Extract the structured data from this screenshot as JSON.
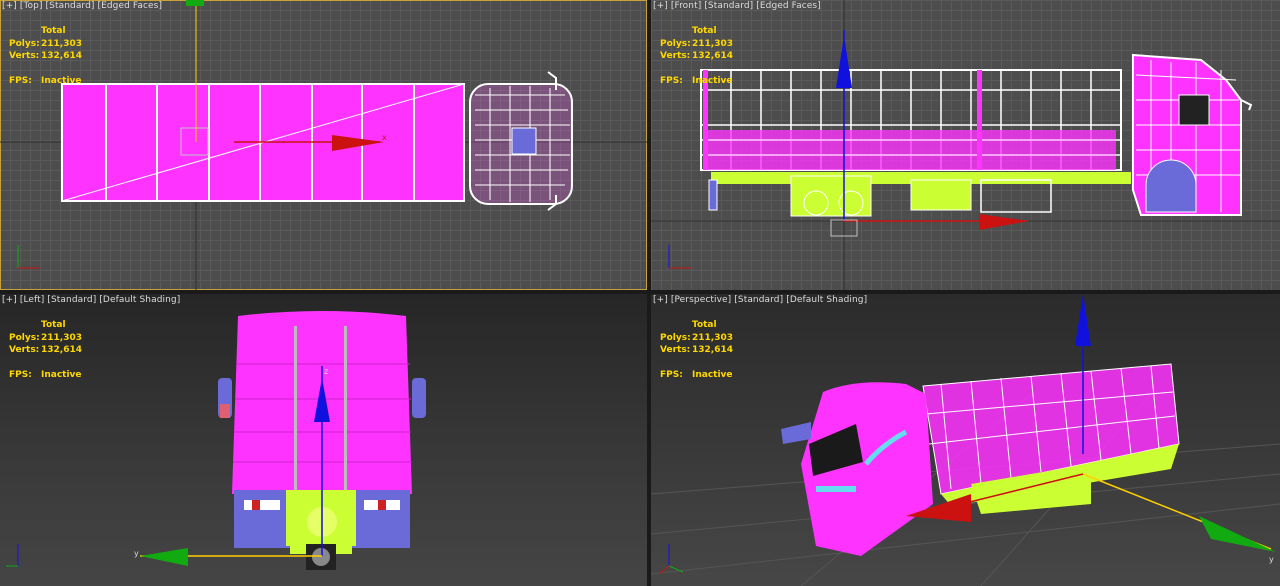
{
  "viewports": {
    "top": {
      "menu": "[+]",
      "view": "[Top]",
      "mode": "[Standard]",
      "shading": "[Edged Faces]"
    },
    "front": {
      "menu": "[+]",
      "view": "[Front]",
      "mode": "[Standard]",
      "shading": "[Edged Faces]"
    },
    "left": {
      "menu": "[+]",
      "view": "[Left]",
      "mode": "[Standard]",
      "shading": "[Default Shading]"
    },
    "perspective": {
      "menu": "[+]",
      "view": "[Perspective]",
      "mode": "[Standard]",
      "shading": "[Default Shading]"
    }
  },
  "stats": {
    "title": "Total",
    "polys_label": "Polys:",
    "polys_value": "211,303",
    "verts_label": "Verts:",
    "verts_value": "132,614",
    "fps_label": "FPS:",
    "fps_value": "Inactive"
  },
  "gizmo": {
    "x": "x",
    "y": "y",
    "z": "z"
  },
  "colors": {
    "body": "#ff33ff",
    "chassis": "#ccff33",
    "trim": "#6a6ad8",
    "cab_wire": "#ffffff",
    "gizmo_x": "#cc1111",
    "gizmo_y": "#11aa11",
    "gizmo_z": "#1111dd",
    "stats_text": "#ffd800",
    "active_border": "#c8a23a"
  }
}
